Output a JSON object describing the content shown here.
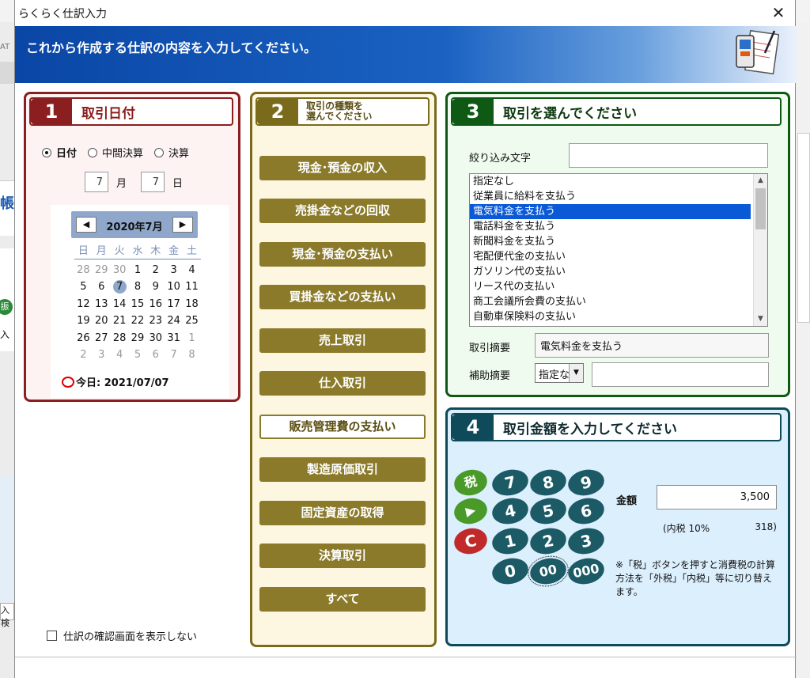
{
  "window": {
    "title": "らくらく仕訳入力",
    "close_label": "✕"
  },
  "banner": {
    "message": "これから作成する仕訳の内容を入力してください。"
  },
  "background_app": {
    "fragments": [
      "AT",
      "帳",
      "振",
      "入",
      "入検"
    ]
  },
  "panel1": {
    "number": "1",
    "title": "取引日付",
    "radios": [
      {
        "label": "日付",
        "checked": true
      },
      {
        "label": "中間決算",
        "checked": false
      },
      {
        "label": "決算",
        "checked": false
      }
    ],
    "month_value": "7",
    "month_unit": "月",
    "day_value": "7",
    "day_unit": "日",
    "calendar": {
      "month_label": "2020年7月",
      "prev": "◀",
      "next": "▶",
      "weekdays": [
        "日",
        "月",
        "火",
        "水",
        "木",
        "金",
        "土"
      ],
      "weeks": [
        [
          "28",
          "29",
          "30",
          "1",
          "2",
          "3",
          "4"
        ],
        [
          "5",
          "6",
          "7",
          "8",
          "9",
          "10",
          "11"
        ],
        [
          "12",
          "13",
          "14",
          "15",
          "16",
          "17",
          "18"
        ],
        [
          "19",
          "20",
          "21",
          "22",
          "23",
          "24",
          "25"
        ],
        [
          "26",
          "27",
          "28",
          "29",
          "30",
          "31",
          "1"
        ],
        [
          "2",
          "3",
          "4",
          "5",
          "6",
          "7",
          "8"
        ]
      ],
      "today_label": "今日: 2021/07/07"
    }
  },
  "panel2": {
    "number": "2",
    "title_line1": "取引の種類を",
    "title_line2": "選んでください",
    "buttons": [
      "現金･預金の収入",
      "売掛金などの回収",
      "現金･預金の支払い",
      "買掛金などの支払い",
      "売上取引",
      "仕入取引",
      "販売管理費の支払い",
      "製造原価取引",
      "固定資産の取得",
      "決算取引",
      "すべて"
    ],
    "active_index": 6
  },
  "panel3": {
    "number": "3",
    "title": "取引を選んでください",
    "filter_label": "絞り込み文字",
    "filter_value": "",
    "list_items": [
      "指定なし",
      "従業員に給料を支払う",
      "電気料金を支払う",
      "電話料金を支払う",
      "新聞料金を支払う",
      "宅配便代金の支払い",
      "ガソリン代の支払い",
      "リース代の支払い",
      "商工会議所会費の支払い",
      "自動車保険料の支払い"
    ],
    "selected_index": 2,
    "summary_label": "取引摘要",
    "summary_value": "電気料金を支払う",
    "aux_label": "補助摘要",
    "aux_select": "指定なし",
    "aux_value": ""
  },
  "panel4": {
    "number": "4",
    "title": "取引金額を入力してください",
    "keys": {
      "tax": "税",
      "play": "▶",
      "clear": "C",
      "k7": "7",
      "k8": "8",
      "k9": "9",
      "k4": "4",
      "k5": "5",
      "k6": "6",
      "k1": "1",
      "k2": "2",
      "k3": "3",
      "k0": "0",
      "k00": "00",
      "k000": "000"
    },
    "amount_label": "金額",
    "amount_value": "3,500",
    "tax_info_label": "(内税 10%",
    "tax_info_value": "318)",
    "note": "※「税」ボタンを押すと消費税の計算方法を「外税」「内税」等に切り替えます。"
  },
  "footer": {
    "checkbox_label": "仕訳の確認画面を表示しない",
    "checked": false
  }
}
